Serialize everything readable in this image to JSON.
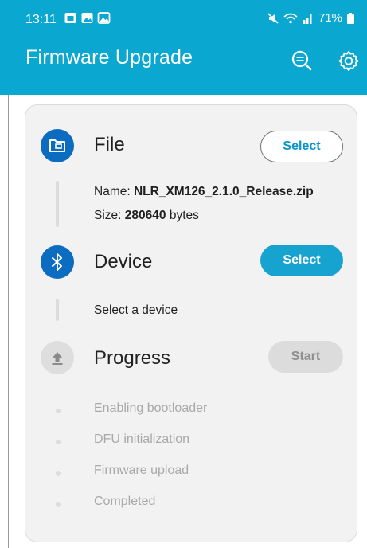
{
  "status_bar": {
    "time": "13:11",
    "battery": "71%"
  },
  "app_bar": {
    "title": "Firmware Upgrade",
    "actions": [
      "search-icon",
      "settings-icon"
    ],
    "color": "#0aa8d0"
  },
  "file_section": {
    "title": "File",
    "button": "Select",
    "name_label": "Name:",
    "name_value": "NLR_XM126_2.1.0_Release.zip",
    "size_label": "Size:",
    "size_value": "280640",
    "size_unit": "bytes"
  },
  "device_section": {
    "title": "Device",
    "button": "Select",
    "hint": "Select a device"
  },
  "progress_section": {
    "title": "Progress",
    "button": "Start",
    "steps": [
      "Enabling bootloader",
      "DFU initialization",
      "Firmware upload",
      "Completed"
    ]
  },
  "colors": {
    "accent": "#16a3cf",
    "icon_blue": "#0b6cc0",
    "disabled": "#dcdcdc"
  }
}
